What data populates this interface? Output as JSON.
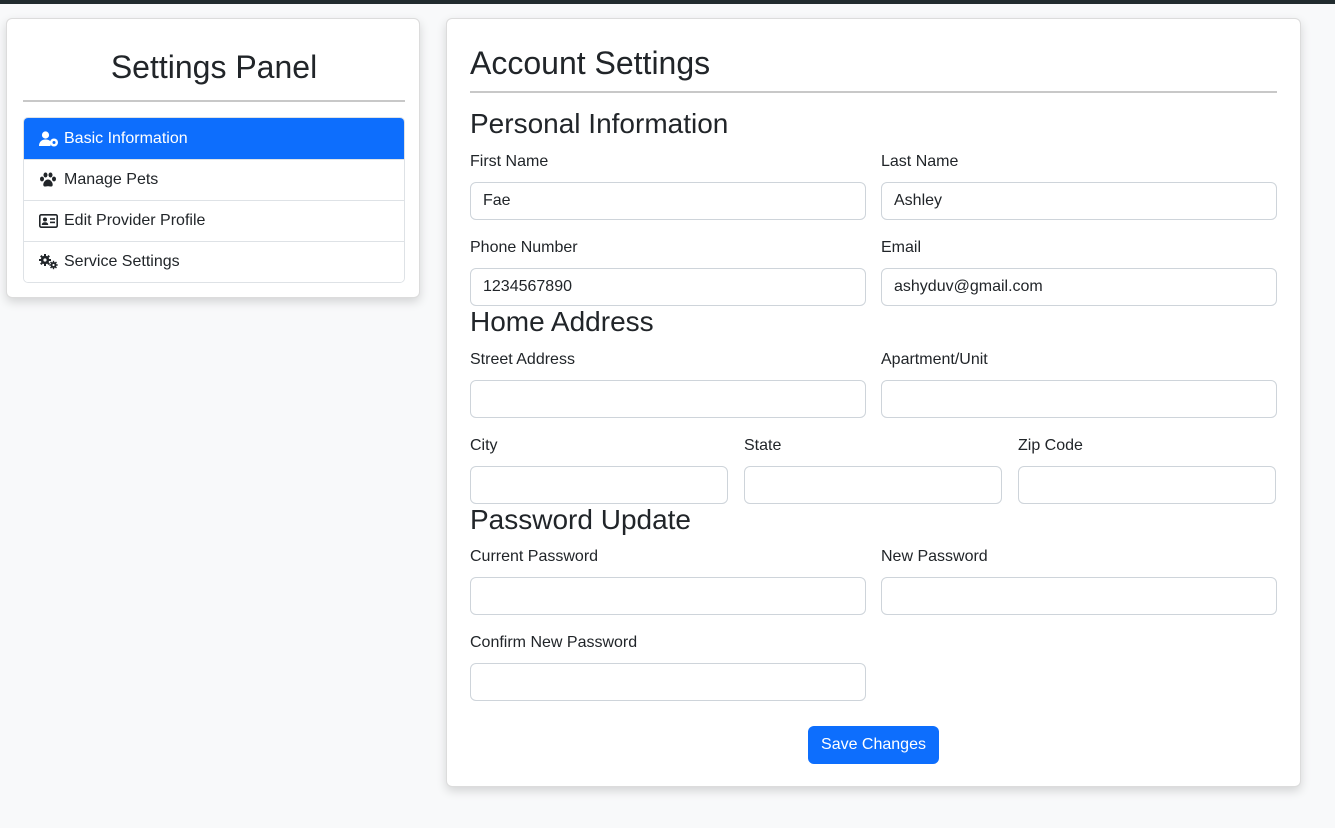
{
  "sidebar": {
    "title": "Settings Panel",
    "items": [
      {
        "label": "Basic Information",
        "icon": "user-gear-icon",
        "active": true
      },
      {
        "label": "Manage Pets",
        "icon": "paw-icon",
        "active": false
      },
      {
        "label": "Edit Provider Profile",
        "icon": "id-card-icon",
        "active": false
      },
      {
        "label": "Service Settings",
        "icon": "gears-icon",
        "active": false
      }
    ]
  },
  "main": {
    "title": "Account Settings",
    "personal": {
      "heading": "Personal Information",
      "first_name": {
        "label": "First Name",
        "value": "Fae"
      },
      "last_name": {
        "label": "Last Name",
        "value": "Ashley"
      },
      "phone": {
        "label": "Phone Number",
        "value": "1234567890"
      },
      "email": {
        "label": "Email",
        "value": "ashyduv@gmail.com"
      }
    },
    "address": {
      "heading": "Home Address",
      "street": {
        "label": "Street Address",
        "value": ""
      },
      "apartment": {
        "label": "Apartment/Unit",
        "value": ""
      },
      "city": {
        "label": "City",
        "value": ""
      },
      "state": {
        "label": "State",
        "value": ""
      },
      "zip": {
        "label": "Zip Code",
        "value": ""
      }
    },
    "password": {
      "heading": "Password Update",
      "current": {
        "label": "Current Password",
        "value": ""
      },
      "new": {
        "label": "New Password",
        "value": ""
      },
      "confirm": {
        "label": "Confirm New Password",
        "value": ""
      }
    },
    "save_label": "Save Changes"
  },
  "colors": {
    "accent": "#0d6efd",
    "topbar": "#212b2e",
    "background": "#f8f9fa"
  }
}
